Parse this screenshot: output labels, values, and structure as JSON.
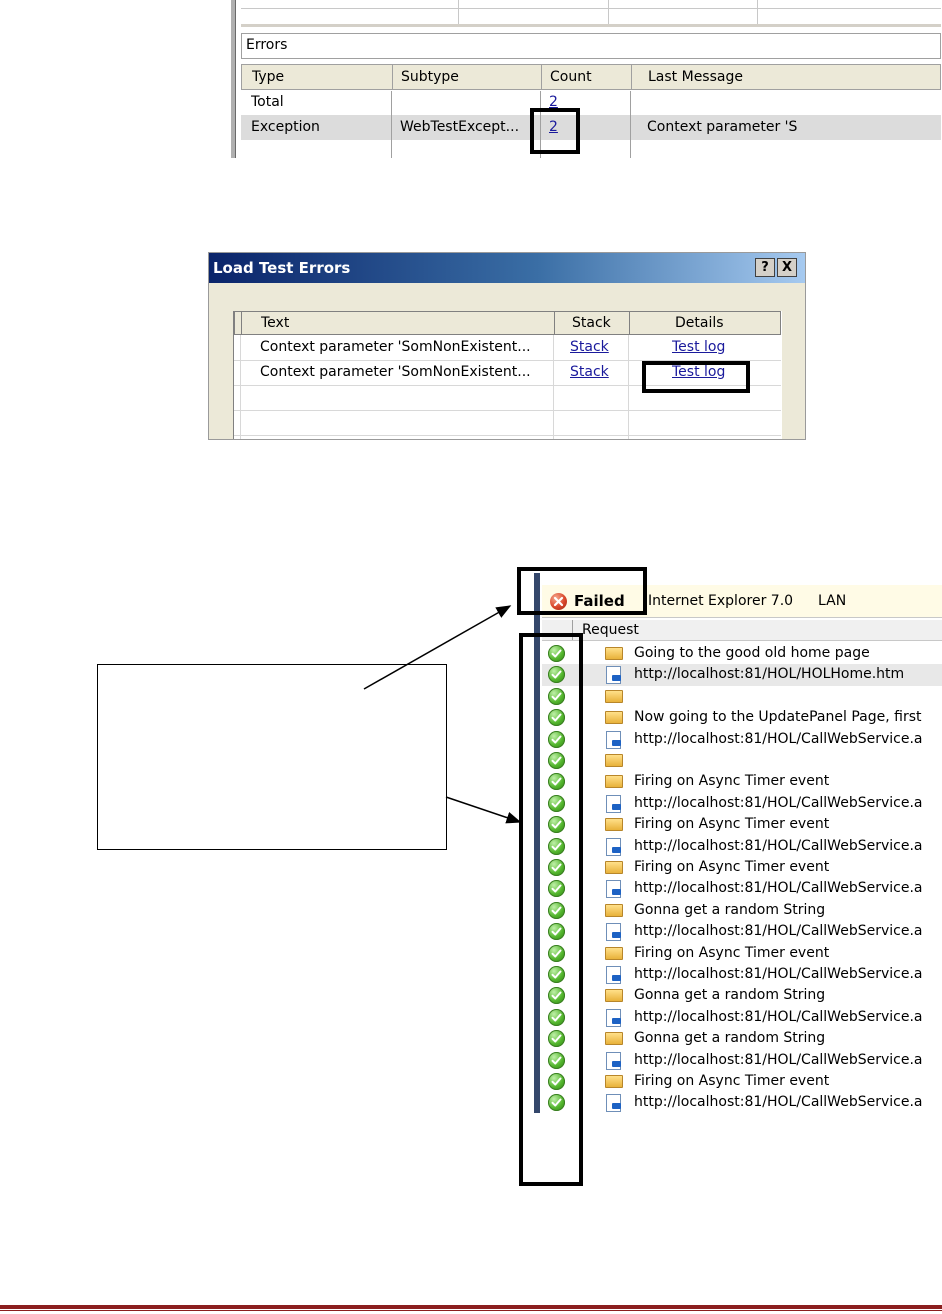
{
  "errors_section": {
    "panel_title": "Errors",
    "columns": [
      "Type",
      "Subtype",
      "Count",
      "Last Message"
    ],
    "rows": [
      {
        "type": "Total",
        "subtype": "",
        "count": "2",
        "last_message": ""
      },
      {
        "type": "Exception",
        "subtype": "WebTestExcept...",
        "count": "2",
        "last_message": "Context parameter 'S"
      }
    ]
  },
  "dialog": {
    "title": "Load Test Errors",
    "help_label": "?",
    "close_label": "X",
    "columns": [
      "Text",
      "Stack",
      "Details"
    ],
    "rows": [
      {
        "text": "Context parameter 'SomNonExistent...",
        "stack": "Stack",
        "details": "Test log"
      },
      {
        "text": "Context parameter 'SomNonExistent...",
        "stack": "Stack",
        "details": "Test log"
      }
    ]
  },
  "results": {
    "status": "Failed",
    "browser": "Internet Explorer 7.0",
    "network": "LAN",
    "column_header": "Request",
    "rows": [
      {
        "kind": "folder",
        "text": "Going to the good old home page"
      },
      {
        "kind": "page",
        "text": "http://localhost:81/HOL/HOLHome.htm"
      },
      {
        "kind": "folder",
        "text": ""
      },
      {
        "kind": "folder",
        "text": "Now going to the UpdatePanel Page, first"
      },
      {
        "kind": "page",
        "text": "http://localhost:81/HOL/CallWebService.a"
      },
      {
        "kind": "folder",
        "text": ""
      },
      {
        "kind": "folder",
        "text": "Firing on Async Timer event"
      },
      {
        "kind": "page",
        "text": "http://localhost:81/HOL/CallWebService.a"
      },
      {
        "kind": "folder",
        "text": "Firing on Async Timer event"
      },
      {
        "kind": "page",
        "text": "http://localhost:81/HOL/CallWebService.a"
      },
      {
        "kind": "folder",
        "text": "Firing on Async Timer event"
      },
      {
        "kind": "page",
        "text": "http://localhost:81/HOL/CallWebService.a"
      },
      {
        "kind": "folder",
        "text": "Gonna get a random String"
      },
      {
        "kind": "page",
        "text": "http://localhost:81/HOL/CallWebService.a"
      },
      {
        "kind": "folder",
        "text": "Firing on Async Timer event"
      },
      {
        "kind": "page",
        "text": "http://localhost:81/HOL/CallWebService.a"
      },
      {
        "kind": "folder",
        "text": "Gonna get a random String"
      },
      {
        "kind": "page",
        "text": "http://localhost:81/HOL/CallWebService.a"
      },
      {
        "kind": "folder",
        "text": "Gonna get a random String"
      },
      {
        "kind": "page",
        "text": "http://localhost:81/HOL/CallWebService.a"
      },
      {
        "kind": "folder",
        "text": "Firing on Async Timer event"
      },
      {
        "kind": "page",
        "text": "http://localhost:81/HOL/CallWebService.a"
      }
    ]
  },
  "colors": {
    "footer_rule": "#8b1e1e",
    "title_bar_start": "#0a246a",
    "title_bar_end": "#a6caf0",
    "failed_banner": "#fffbe6",
    "success_icon": "#52b52c",
    "error_icon": "#d9472b",
    "left_bar": "#34476b"
  }
}
